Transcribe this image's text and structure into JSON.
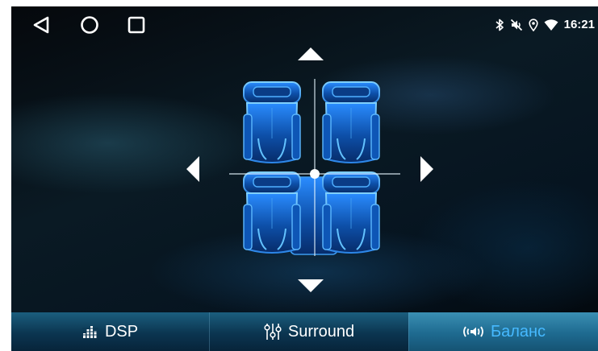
{
  "status_bar": {
    "time": "16:21",
    "icons": [
      "bluetooth-icon",
      "mute-icon",
      "location-icon",
      "wifi-icon"
    ]
  },
  "navigation": {
    "icons": [
      "back-icon",
      "home-icon",
      "recents-icon"
    ]
  },
  "balance_control": {
    "arrows": [
      "arrow-up-icon",
      "arrow-down-icon",
      "arrow-left-icon",
      "arrow-right-icon"
    ],
    "seat_icon": "car-seat-icon"
  },
  "tabs": [
    {
      "label": "DSP",
      "icon": "equalizer-icon",
      "active": false
    },
    {
      "label": "Surround",
      "icon": "sliders-icon",
      "active": false
    },
    {
      "label": "Баланс",
      "icon": "speaker-icon",
      "active": true
    }
  ],
  "colors": {
    "accent": "#46b9ff",
    "tab_bar": "#0b3550",
    "seat_glow": "#1e8cff"
  }
}
